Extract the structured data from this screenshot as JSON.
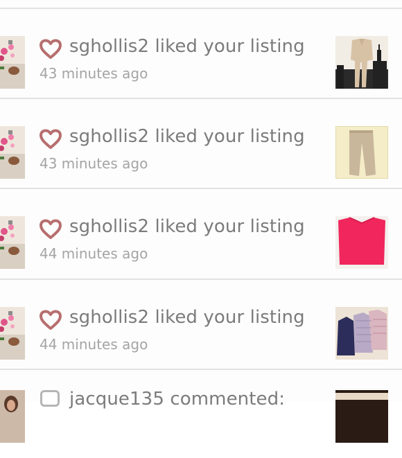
{
  "notifications": [
    {
      "type": "like",
      "username": "sghollis2",
      "message": "sghollis2 liked your listing",
      "time": "43 minutes ago",
      "thumbnail": "beige-pantsuit"
    },
    {
      "type": "like",
      "username": "sghollis2",
      "message": "sghollis2 liked your listing",
      "time": "43 minutes ago",
      "thumbnail": "tan-trousers"
    },
    {
      "type": "like",
      "username": "sghollis2",
      "message": "sghollis2 liked your listing",
      "time": "44 minutes ago",
      "thumbnail": "pink-top"
    },
    {
      "type": "like",
      "username": "sghollis2",
      "message": "sghollis2 liked your listing",
      "time": "44 minutes ago",
      "thumbnail": "tops-bundle"
    },
    {
      "type": "comment",
      "username": "jacque135",
      "message": "jacque135 commented:"
    }
  ],
  "colors": {
    "heart": "#b76e6e",
    "text": "#7b7b7b",
    "timestamp": "#a4a4a4",
    "divider": "#e2e2e2"
  }
}
